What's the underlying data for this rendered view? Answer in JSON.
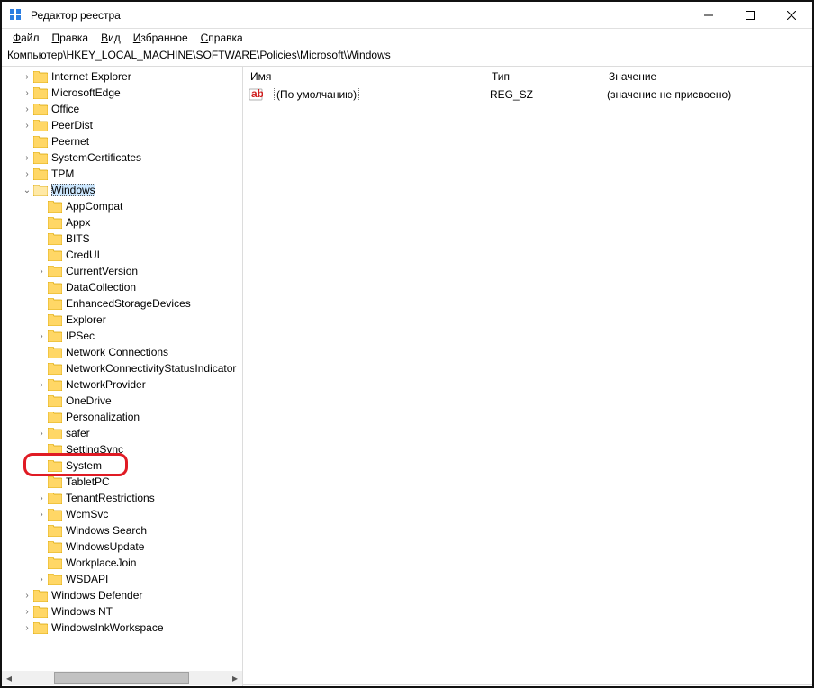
{
  "title": "Редактор реестра",
  "menu": {
    "file": "Файл",
    "edit": "Правка",
    "view": "Вид",
    "favorites": "Избранное",
    "help": "Справка"
  },
  "menu_u": {
    "file": "Ф",
    "edit": "П",
    "view": "В",
    "favorites": "И",
    "help": "С"
  },
  "address": "Компьютер\\HKEY_LOCAL_MACHINE\\SOFTWARE\\Policies\\Microsoft\\Windows",
  "columns": {
    "name": "Имя",
    "type": "Тип",
    "value": "Значение"
  },
  "row": {
    "name": "(По умолчанию)",
    "type": "REG_SZ",
    "value": "(значение не присвоено)"
  },
  "tree_top": [
    {
      "label": "Internet Explorer",
      "indent": 1,
      "exp": ">"
    },
    {
      "label": "MicrosoftEdge",
      "indent": 1,
      "exp": ">"
    },
    {
      "label": "Office",
      "indent": 1,
      "exp": ">"
    },
    {
      "label": "PeerDist",
      "indent": 1,
      "exp": ">"
    },
    {
      "label": "Peernet",
      "indent": 1,
      "exp": ""
    },
    {
      "label": "SystemCertificates",
      "indent": 1,
      "exp": ">"
    },
    {
      "label": "TPM",
      "indent": 1,
      "exp": ">"
    }
  ],
  "tree_windows": {
    "label": "Windows",
    "indent": 1,
    "exp": "v",
    "selected": true
  },
  "tree_children": [
    {
      "label": "AppCompat",
      "indent": 2,
      "exp": ""
    },
    {
      "label": "Appx",
      "indent": 2,
      "exp": ""
    },
    {
      "label": "BITS",
      "indent": 2,
      "exp": ""
    },
    {
      "label": "CredUI",
      "indent": 2,
      "exp": ""
    },
    {
      "label": "CurrentVersion",
      "indent": 2,
      "exp": ">"
    },
    {
      "label": "DataCollection",
      "indent": 2,
      "exp": ""
    },
    {
      "label": "EnhancedStorageDevices",
      "indent": 2,
      "exp": ""
    },
    {
      "label": "Explorer",
      "indent": 2,
      "exp": ""
    },
    {
      "label": "IPSec",
      "indent": 2,
      "exp": ">"
    },
    {
      "label": "Network Connections",
      "indent": 2,
      "exp": ""
    },
    {
      "label": "NetworkConnectivityStatusIndicator",
      "indent": 2,
      "exp": ""
    },
    {
      "label": "NetworkProvider",
      "indent": 2,
      "exp": ">"
    },
    {
      "label": "OneDrive",
      "indent": 2,
      "exp": ""
    },
    {
      "label": "Personalization",
      "indent": 2,
      "exp": ""
    },
    {
      "label": "safer",
      "indent": 2,
      "exp": ">"
    },
    {
      "label": "SettingSync",
      "indent": 2,
      "exp": ""
    },
    {
      "label": "System",
      "indent": 2,
      "exp": "",
      "highlight": true
    },
    {
      "label": "TabletPC",
      "indent": 2,
      "exp": ""
    },
    {
      "label": "TenantRestrictions",
      "indent": 2,
      "exp": ">"
    },
    {
      "label": "WcmSvc",
      "indent": 2,
      "exp": ">"
    },
    {
      "label": "Windows Search",
      "indent": 2,
      "exp": ""
    },
    {
      "label": "WindowsUpdate",
      "indent": 2,
      "exp": ""
    },
    {
      "label": "WorkplaceJoin",
      "indent": 2,
      "exp": ""
    },
    {
      "label": "WSDAPI",
      "indent": 2,
      "exp": ">"
    }
  ],
  "tree_bottom": [
    {
      "label": "Windows Defender",
      "indent": 1,
      "exp": ">"
    },
    {
      "label": "Windows NT",
      "indent": 1,
      "exp": ">"
    },
    {
      "label": "WindowsInkWorkspace",
      "indent": 1,
      "exp": ">"
    }
  ],
  "col_widths": {
    "name": 268,
    "type": 130,
    "value": 200
  }
}
